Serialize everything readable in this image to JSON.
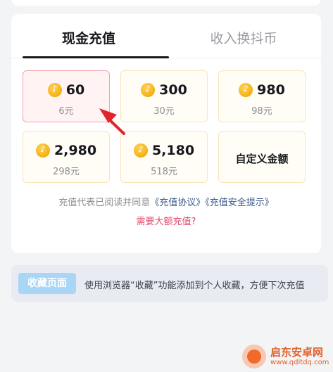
{
  "tabs": [
    {
      "label": "现金充值",
      "active": true
    },
    {
      "label": "收入换抖币",
      "active": false
    }
  ],
  "packages": [
    {
      "amount": "60",
      "price": "6元",
      "selected": true
    },
    {
      "amount": "300",
      "price": "30元",
      "selected": false
    },
    {
      "amount": "980",
      "price": "98元",
      "selected": false
    },
    {
      "amount": "2,980",
      "price": "298元",
      "selected": false
    },
    {
      "amount": "5,180",
      "price": "518元",
      "selected": false
    }
  ],
  "custom_amount_label": "自定义金额",
  "agreement": {
    "prefix": "充值代表已阅读并同意",
    "link1": "《充值协议》",
    "link2": "《充值安全提示》"
  },
  "large_recharge": "需要大额充值?",
  "bookmark": {
    "button_label": "收藏页面",
    "tip": "使用浏览器“收藏”功能添加到个人收藏，方便下次充值"
  },
  "watermark": {
    "title": "启东安卓网",
    "url": "www.qdltdq.com"
  },
  "colors": {
    "selected_border": "#f2a3ae",
    "accent_pink": "#e24a6b",
    "link_blue": "#3c5a8c",
    "coin_gold": "#f6b51a",
    "annotation_arrow": "#e0262b"
  }
}
